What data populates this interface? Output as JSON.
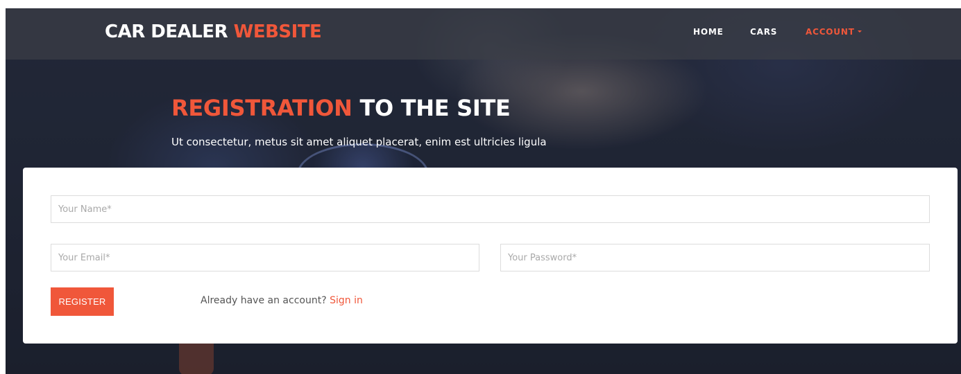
{
  "brand": {
    "part1": "CAR DEALER",
    "part2": "WEBSITE"
  },
  "nav": {
    "home": "HOME",
    "cars": "CARS",
    "account": "ACCOUNT"
  },
  "hero": {
    "title_accent": "REGISTRATION",
    "title_rest": "TO THE SITE",
    "subtitle": "Ut consectetur, metus sit amet aliquet placerat, enim est ultricies ligula"
  },
  "form": {
    "name_placeholder": "Your Name*",
    "email_placeholder": "Your Email*",
    "password_placeholder": "Your Password*",
    "register_label": "REGISTER",
    "signin_prompt": "Already have an account?",
    "signin_link": "Sign in"
  },
  "colors": {
    "accent": "#f0573a",
    "navbar": "#3c3e46",
    "hero_bg": "#262d40",
    "card": "#ffffff"
  },
  "icons": {
    "account_dropdown": "caret-down-icon"
  }
}
